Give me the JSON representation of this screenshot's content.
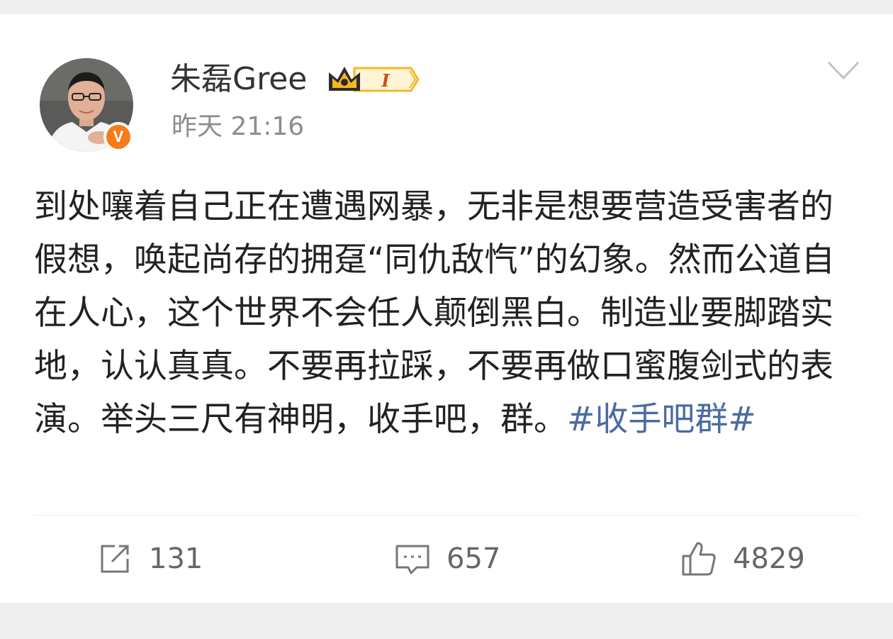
{
  "post": {
    "author": {
      "name": "朱磊Gree",
      "verified_mark": "V",
      "vip_level": "I"
    },
    "timestamp": "昨天 21:16",
    "content_text": "到处嚷着自己正在遭遇网暴，无非是想要营造受害者的假想，唤起尚存的拥趸“同仇敌忾”的幻象。然而公道自在人心，这个世界不会任人颠倒黑白。制造业要脚踏实地，认认真真。不要再拉踩，不要再做口蜜腹剑式的表演。举头三尺有神明，收手吧，",
    "content_tail": "群。",
    "hashtag": "#收手吧群#"
  },
  "actions": {
    "repost_count": "131",
    "comment_count": "657",
    "like_count": "4829"
  },
  "colors": {
    "hashtag": "#4a6ba3",
    "verified_badge": "#f77b19",
    "vip_badge": "#f5b820",
    "page_background": "#efefef"
  },
  "icons": [
    "crown-icon",
    "chevron-down-icon",
    "repost-icon",
    "comment-icon",
    "like-icon"
  ]
}
